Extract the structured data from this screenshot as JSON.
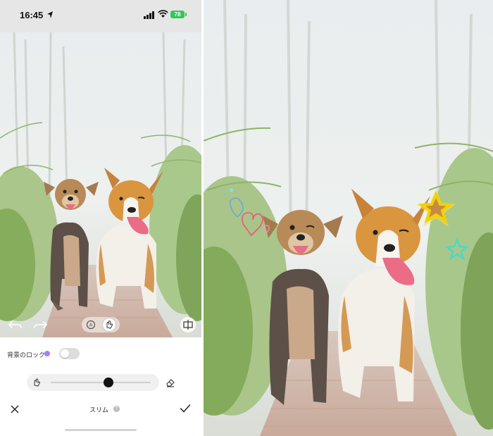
{
  "status_bar": {
    "time": "16:45",
    "battery_level": "78",
    "icons": [
      "location-arrow-icon",
      "signal-icon",
      "wifi-icon",
      "battery-icon"
    ]
  },
  "editor": {
    "toolbar": {
      "icons": [
        "undo-icon",
        "redo-icon",
        "auto-mode-icon",
        "manual-hand-icon",
        "compare-icon"
      ]
    },
    "panel": {
      "lock_background_label": "背景のロック",
      "lock_background_on": false,
      "brush_level": 0.58,
      "tool_name": "スリム",
      "icons": [
        "hand-brush-icon",
        "eraser-icon",
        "close-icon",
        "help-icon",
        "check-icon"
      ]
    }
  },
  "result_photo": {
    "stickers": [
      "heart-doodle-sticker",
      "star-sticker"
    ]
  },
  "colors": {
    "status_bg": "#e6e6e6",
    "battery": "#34c759",
    "star_sticker": "#f2d200",
    "star_outline": "#4fd8c0",
    "heart_doodle": "#e55b73"
  }
}
